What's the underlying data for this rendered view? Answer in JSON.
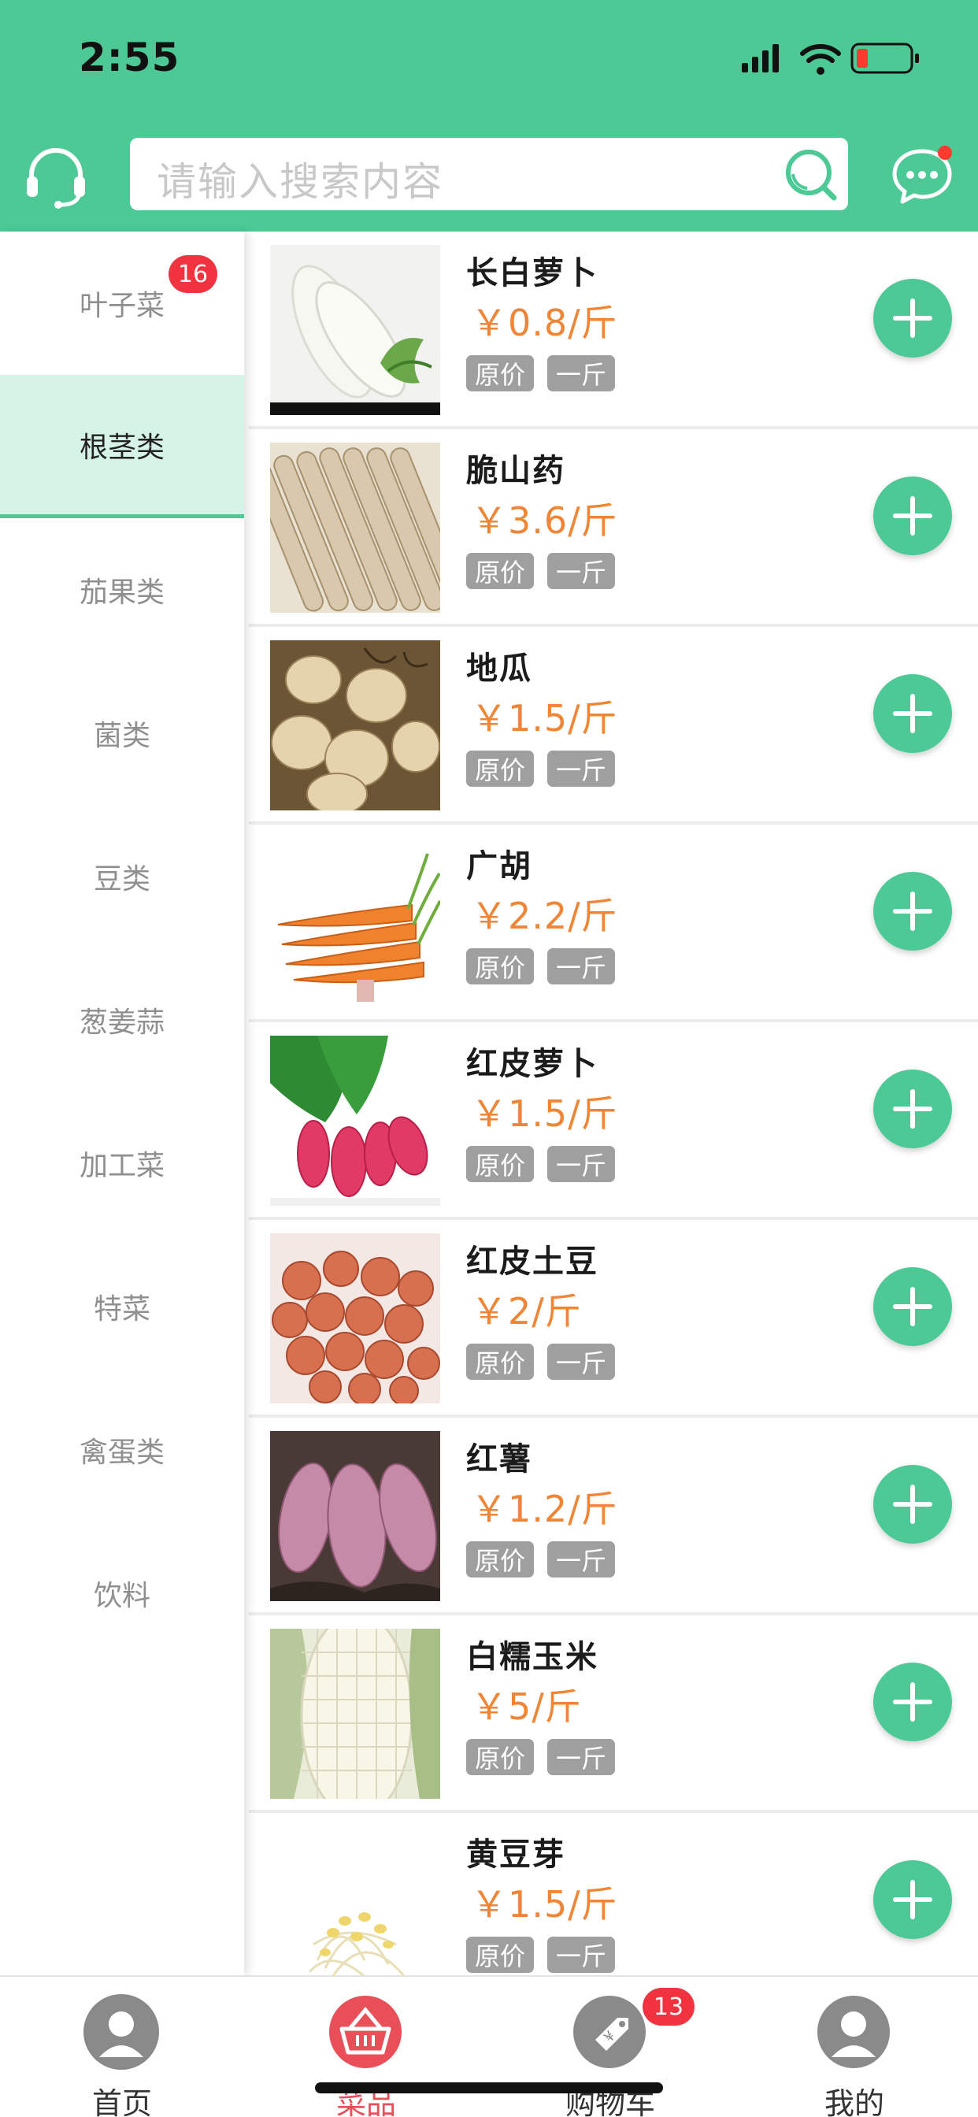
{
  "status_bar": {
    "time": "2:55"
  },
  "search": {
    "placeholder": "请输入搜索内容"
  },
  "colors": {
    "brand": "#4dc996",
    "price": "#f08535",
    "badge": "#f0333f",
    "active_tab": "#e94f58"
  },
  "sidebar": {
    "items": [
      {
        "label": "叶子菜",
        "badge": "16"
      },
      {
        "label": "根茎类",
        "active": true
      },
      {
        "label": "茄果类"
      },
      {
        "label": "菌类"
      },
      {
        "label": "豆类"
      },
      {
        "label": "葱姜蒜"
      },
      {
        "label": "加工菜"
      },
      {
        "label": "特菜"
      },
      {
        "label": "禽蛋类"
      },
      {
        "label": "饮料"
      }
    ]
  },
  "products": [
    {
      "name": "长白萝卜",
      "price": "￥0.8/斤",
      "tag_original": "原价",
      "tag_unit": "一斤",
      "image": "white-radish"
    },
    {
      "name": "脆山药",
      "price": "￥3.6/斤",
      "tag_original": "原价",
      "tag_unit": "一斤",
      "image": "yam"
    },
    {
      "name": "地瓜",
      "price": "￥1.5/斤",
      "tag_original": "原价",
      "tag_unit": "一斤",
      "image": "jicama"
    },
    {
      "name": "广胡",
      "price": "￥2.2/斤",
      "tag_original": "原价",
      "tag_unit": "一斤",
      "image": "carrot"
    },
    {
      "name": "红皮萝卜",
      "price": "￥1.5/斤",
      "tag_original": "原价",
      "tag_unit": "一斤",
      "image": "red-radish"
    },
    {
      "name": "红皮土豆",
      "price": "￥2/斤",
      "tag_original": "原价",
      "tag_unit": "一斤",
      "image": "red-potato"
    },
    {
      "name": "红薯",
      "price": "￥1.2/斤",
      "tag_original": "原价",
      "tag_unit": "一斤",
      "image": "sweet-potato"
    },
    {
      "name": "白糯玉米",
      "price": "￥5/斤",
      "tag_original": "原价",
      "tag_unit": "一斤",
      "image": "white-corn"
    },
    {
      "name": "黄豆芽",
      "price": "￥1.5/斤",
      "tag_original": "原价",
      "tag_unit": "一斤",
      "image": "bean-sprouts"
    }
  ],
  "tabbar": {
    "tabs": [
      {
        "label": "首页",
        "icon": "home-avatar-icon"
      },
      {
        "label": "菜品",
        "icon": "basket-icon",
        "active": true
      },
      {
        "label": "购物车",
        "icon": "cart-tag-icon",
        "badge": "13"
      },
      {
        "label": "我的",
        "icon": "profile-icon"
      }
    ]
  }
}
